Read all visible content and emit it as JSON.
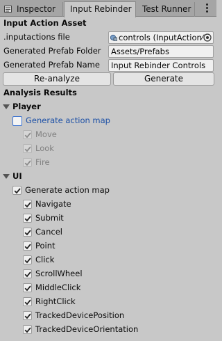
{
  "tabs": [
    {
      "label": "Inspector",
      "active": false
    },
    {
      "label": "Input Rebinder",
      "active": true
    },
    {
      "label": "Test Runner",
      "active": false
    }
  ],
  "asset_header": "Input Action Asset",
  "fields": {
    "inputactions_label": ".inputactions file",
    "inputactions_value": "controls (InputAction⁄",
    "prefab_folder_label": "Generated Prefab Folder",
    "prefab_folder_value": "Assets/Prefabs",
    "prefab_name_label": "Generated Prefab Name",
    "prefab_name_value": "Input Rebinder Controls"
  },
  "buttons": {
    "reanalyze": "Re-analyze",
    "generate": "Generate"
  },
  "results_header": "Analysis Results",
  "player": {
    "title": "Player",
    "generate_label": "Generate action map",
    "generate_checked": false,
    "actions": [
      {
        "label": "Move",
        "checked": true
      },
      {
        "label": "Look",
        "checked": true
      },
      {
        "label": "Fire",
        "checked": true
      }
    ]
  },
  "ui": {
    "title": "UI",
    "generate_label": "Generate action map",
    "generate_checked": true,
    "actions": [
      {
        "label": "Navigate",
        "checked": true
      },
      {
        "label": "Submit",
        "checked": true
      },
      {
        "label": "Cancel",
        "checked": true
      },
      {
        "label": "Point",
        "checked": true
      },
      {
        "label": "Click",
        "checked": true
      },
      {
        "label": "ScrollWheel",
        "checked": true
      },
      {
        "label": "MiddleClick",
        "checked": true
      },
      {
        "label": "RightClick",
        "checked": true
      },
      {
        "label": "TrackedDevicePosition",
        "checked": true
      },
      {
        "label": "TrackedDeviceOrientation",
        "checked": true
      }
    ]
  },
  "icons": {
    "inspector_tab": "inspector-icon",
    "asset": "input-actions-asset-icon",
    "picker": "object-picker-icon",
    "menu": "kebab-menu-icon"
  },
  "colors": {
    "accent": "#3a72d0",
    "link_blue": "#1b4fa6",
    "panel": "#c8c8c8",
    "tabbar": "#a5a5a5"
  }
}
